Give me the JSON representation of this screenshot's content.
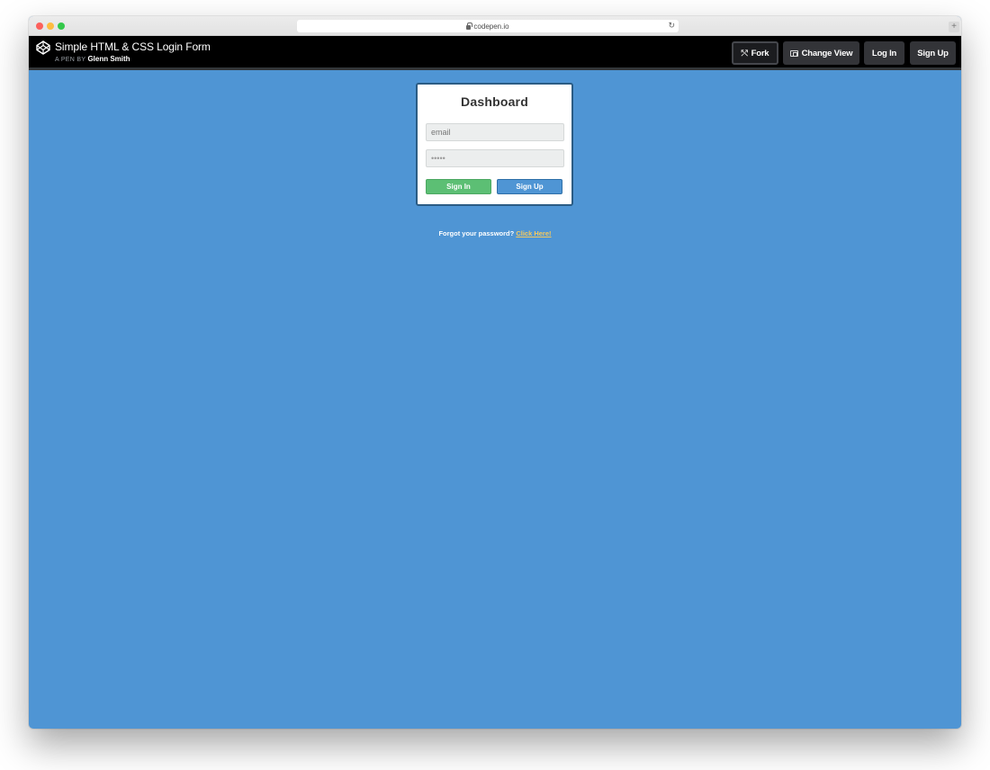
{
  "browser": {
    "url": "codepen.io"
  },
  "header": {
    "pen_title": "Simple HTML & CSS Login Form",
    "byline_prefix": "A PEN BY",
    "author": "Glenn Smith",
    "buttons": {
      "fork": "Fork",
      "change_view": "Change View",
      "log_in": "Log In",
      "sign_up": "Sign Up"
    }
  },
  "login_card": {
    "title": "Dashboard",
    "email_placeholder": "email",
    "password_value": "•••••",
    "sign_in_label": "Sign In",
    "sign_up_label": "Sign Up"
  },
  "footer": {
    "forgot_text": "Forgot your password?",
    "forgot_link": "Click Here!"
  },
  "colors": {
    "page_background": "#4f95d4",
    "header_background": "#000000",
    "sign_in_button": "#5cbf74",
    "sign_up_button": "#4f95d4",
    "link": "#f5c95f"
  },
  "icons": {
    "logo": "codepen-logo-icon",
    "lock": "lock-icon",
    "reload": "reload-icon",
    "fork": "fork-icon",
    "change_view": "layout-icon"
  }
}
